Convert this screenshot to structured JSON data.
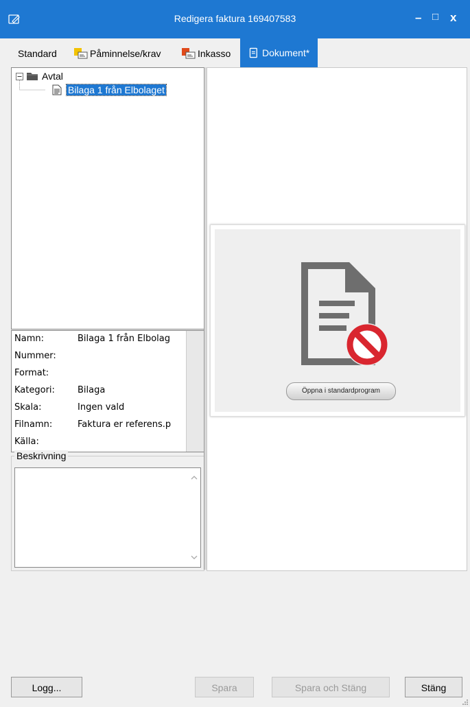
{
  "window": {
    "title": "Redigera faktura 169407583",
    "minimize_glyph": "–",
    "maximize_glyph": "□",
    "close_glyph": "x"
  },
  "tabs": [
    {
      "label": "Standard",
      "icon": ""
    },
    {
      "label": "Påminnelse/krav",
      "icon": "reminder-icon"
    },
    {
      "label": "Inkasso",
      "icon": "collection-icon"
    },
    {
      "label": "Dokument*",
      "icon": "document-icon",
      "active": true
    }
  ],
  "tree": {
    "folder_label": "Avtal",
    "item_label": "Bilaga 1 från Elbolaget"
  },
  "properties": [
    {
      "label": "Namn:",
      "value": "Bilaga 1 från Elbolag"
    },
    {
      "label": "Nummer:",
      "value": ""
    },
    {
      "label": "Format:",
      "value": ""
    },
    {
      "label": "Kategori:",
      "value": "Bilaga"
    },
    {
      "label": "Skala:",
      "value": "Ingen vald"
    },
    {
      "label": "Filnamn:",
      "value": "Faktura er referens.p"
    },
    {
      "label": "Källa:",
      "value": ""
    }
  ],
  "description": {
    "legend": "Beskrivning",
    "value": ""
  },
  "preview": {
    "open_button_label": "Öppna i standardprogram"
  },
  "footer": {
    "log_label": "Logg...",
    "save_label": "Spara",
    "save_close_label": "Spara och Stäng",
    "close_label": "Stäng"
  },
  "colors": {
    "accent": "#1e78d2",
    "no_sign": "#d9262f"
  }
}
